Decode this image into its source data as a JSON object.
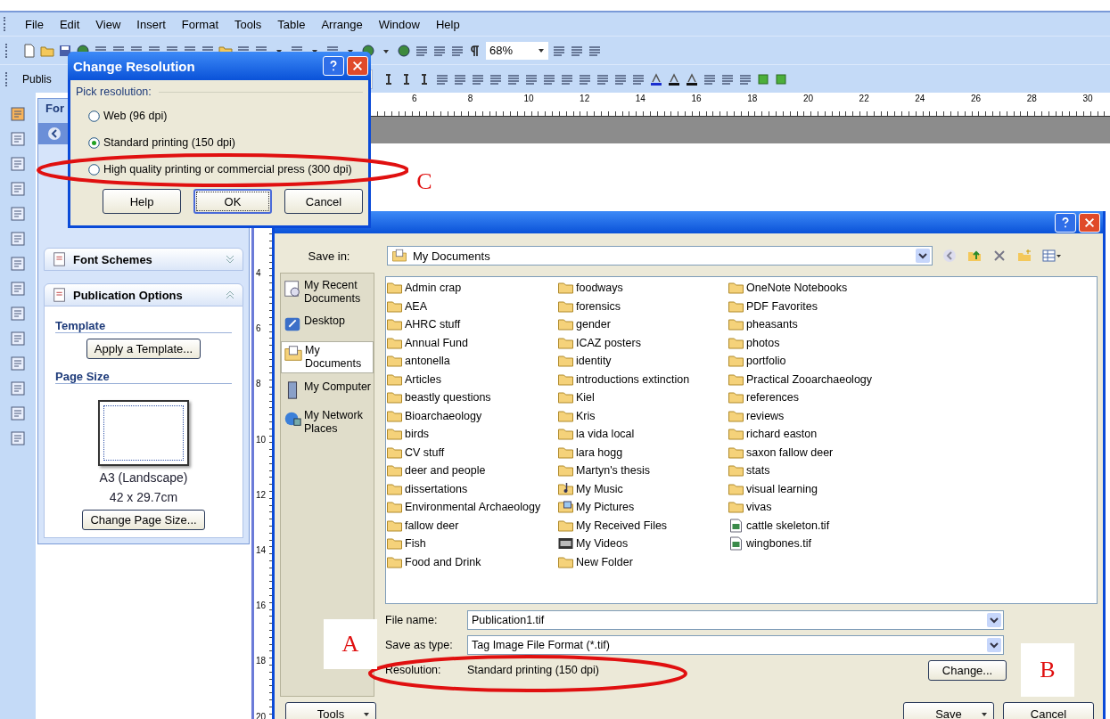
{
  "menu_bar": [
    "File",
    "Edit",
    "View",
    "Insert",
    "Format",
    "Tools",
    "Table",
    "Arrange",
    "Window",
    "Help"
  ],
  "standard_toolbar": {
    "zoom": "68%"
  },
  "formatting_toolbar": {
    "label": "Publis"
  },
  "horizontal_ruler": [
    "6",
    "8",
    "10",
    "12",
    "14",
    "16",
    "18",
    "20",
    "22",
    "24",
    "26",
    "28",
    "30"
  ],
  "vertical_ruler": [
    "4",
    "6",
    "8",
    "10",
    "12",
    "14",
    "16",
    "18",
    "20"
  ],
  "task_pane": {
    "title": "For",
    "sections": [
      {
        "title": "Font Schemes",
        "expanded": false
      },
      {
        "title": "Publication Options",
        "expanded": true
      }
    ],
    "template_heading": "Template",
    "apply_button": "Apply a Template...",
    "page_size_heading": "Page Size",
    "page_name": "A3 (Landscape)",
    "page_dims": "42 x 29.7cm",
    "change_button": "Change Page Size..."
  },
  "save_dialog": {
    "save_in_label": "Save in:",
    "save_in": "My Documents",
    "places": [
      {
        "label": "My Recent Documents",
        "kind": "recent",
        "selected": false
      },
      {
        "label": "Desktop",
        "kind": "desktop",
        "selected": false
      },
      {
        "label": "My Documents",
        "kind": "documents",
        "selected": true
      },
      {
        "label": "My Computer",
        "kind": "computer",
        "selected": false
      },
      {
        "label": "My Network Places",
        "kind": "network",
        "selected": false
      }
    ],
    "files": [
      {
        "name": "Admin crap",
        "kind": "folder"
      },
      {
        "name": "AEA",
        "kind": "folder"
      },
      {
        "name": "AHRC stuff",
        "kind": "folder"
      },
      {
        "name": "Annual Fund",
        "kind": "folder"
      },
      {
        "name": "antonella",
        "kind": "folder"
      },
      {
        "name": "Articles",
        "kind": "folder"
      },
      {
        "name": "beastly questions",
        "kind": "folder"
      },
      {
        "name": "Bioarchaeology",
        "kind": "folder"
      },
      {
        "name": "birds",
        "kind": "folder"
      },
      {
        "name": "CV stuff",
        "kind": "folder"
      },
      {
        "name": "deer and people",
        "kind": "folder"
      },
      {
        "name": "dissertations",
        "kind": "folder"
      },
      {
        "name": "Environmental Archaeology",
        "kind": "folder"
      },
      {
        "name": "fallow deer",
        "kind": "folder"
      },
      {
        "name": "Fish",
        "kind": "folder"
      },
      {
        "name": "Food and Drink",
        "kind": "folder"
      },
      {
        "name": "foodways",
        "kind": "folder"
      },
      {
        "name": "forensics",
        "kind": "folder"
      },
      {
        "name": "gender",
        "kind": "folder"
      },
      {
        "name": "ICAZ posters",
        "kind": "folder"
      },
      {
        "name": "identity",
        "kind": "folder"
      },
      {
        "name": "introductions extinction",
        "kind": "folder"
      },
      {
        "name": "Kiel",
        "kind": "folder"
      },
      {
        "name": "Kris",
        "kind": "folder"
      },
      {
        "name": "la vida local",
        "kind": "folder"
      },
      {
        "name": "lara hogg",
        "kind": "folder"
      },
      {
        "name": "Martyn's thesis",
        "kind": "folder"
      },
      {
        "name": "My Music",
        "kind": "music"
      },
      {
        "name": "My Pictures",
        "kind": "pictures"
      },
      {
        "name": "My Received Files",
        "kind": "folder"
      },
      {
        "name": "My Videos",
        "kind": "videos"
      },
      {
        "name": "New Folder",
        "kind": "folder"
      },
      {
        "name": "OneNote Notebooks",
        "kind": "folder"
      },
      {
        "name": "PDF Favorites",
        "kind": "folder"
      },
      {
        "name": "pheasants",
        "kind": "folder"
      },
      {
        "name": "photos",
        "kind": "folder"
      },
      {
        "name": "portfolio",
        "kind": "folder"
      },
      {
        "name": "Practical Zooarchaeology",
        "kind": "folder"
      },
      {
        "name": "references",
        "kind": "folder"
      },
      {
        "name": "reviews",
        "kind": "folder"
      },
      {
        "name": "richard easton",
        "kind": "folder"
      },
      {
        "name": "saxon fallow deer",
        "kind": "folder"
      },
      {
        "name": "stats",
        "kind": "folder"
      },
      {
        "name": "visual learning",
        "kind": "folder"
      },
      {
        "name": "vivas",
        "kind": "folder"
      },
      {
        "name": "cattle skeleton.tif",
        "kind": "image"
      },
      {
        "name": "wingbones.tif",
        "kind": "image"
      }
    ],
    "file_name_label": "File name:",
    "file_name": "Publication1.tif",
    "type_label": "Save as type:",
    "type": "Tag Image File Format (*.tif)",
    "resolution_label": "Resolution:",
    "resolution": "Standard printing (150 dpi)",
    "change_button": "Change...",
    "tools_button": "Tools",
    "save_button": "Save",
    "cancel_button": "Cancel"
  },
  "resolution_dialog": {
    "title": "Change Resolution",
    "group_label": "Pick resolution:",
    "options": [
      {
        "label": "Web (96 dpi)",
        "selected": false
      },
      {
        "label": "Standard printing (150 dpi)",
        "selected": true
      },
      {
        "label": "High quality printing or commercial press (300 dpi)",
        "selected": false
      }
    ],
    "buttons": [
      {
        "label": "Help",
        "default": false
      },
      {
        "label": "OK",
        "default": true
      },
      {
        "label": "Cancel",
        "default": false
      }
    ]
  },
  "annotations": [
    {
      "label": "A"
    },
    {
      "label": "B"
    },
    {
      "label": "C"
    }
  ]
}
